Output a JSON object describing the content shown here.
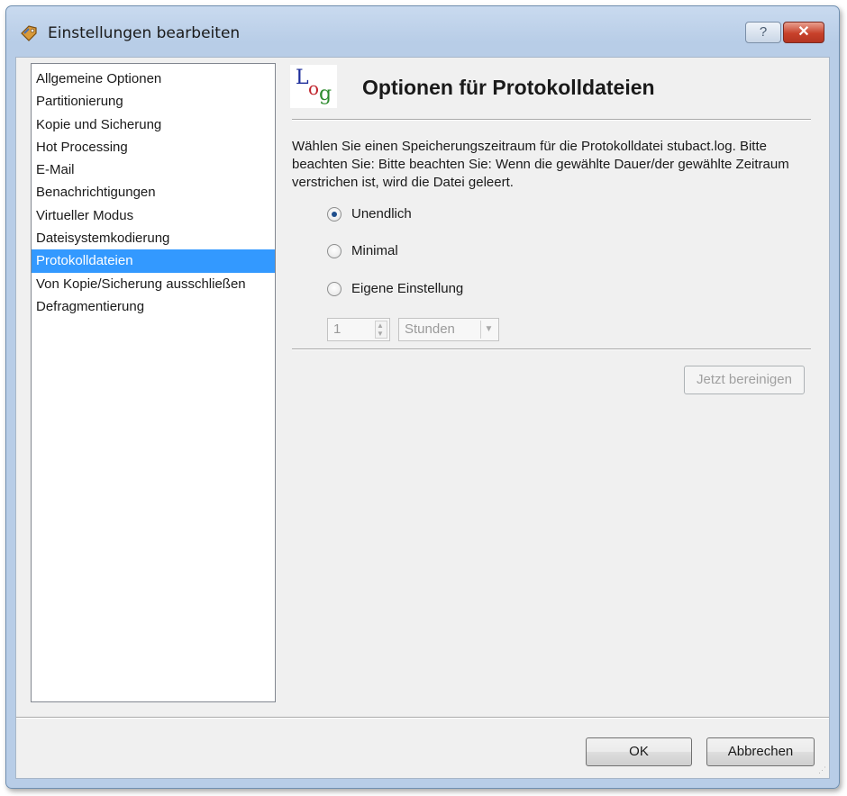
{
  "window": {
    "title": "Einstellungen bearbeiten",
    "help_label": "?",
    "close_label": "✕",
    "title_icon": "settings-tag-icon"
  },
  "sidebar": {
    "items": [
      {
        "label": "Allgemeine Optionen",
        "selected": false
      },
      {
        "label": "Partitionierung",
        "selected": false
      },
      {
        "label": "Kopie und Sicherung",
        "selected": false
      },
      {
        "label": "Hot Processing",
        "selected": false
      },
      {
        "label": "E-Mail",
        "selected": false
      },
      {
        "label": "Benachrichtigungen",
        "selected": false
      },
      {
        "label": "Virtueller Modus",
        "selected": false
      },
      {
        "label": "Dateisystemkodierung",
        "selected": false
      },
      {
        "label": "Protokolldateien",
        "selected": true
      },
      {
        "label": "Von Kopie/Sicherung ausschließen",
        "selected": false
      },
      {
        "label": "Defragmentierung",
        "selected": false
      }
    ]
  },
  "panel": {
    "logo": {
      "l": "L",
      "o": "o",
      "g": "g"
    },
    "title": "Optionen für Protokolldateien",
    "description": "Wählen Sie einen Speicherungszeitraum für die Protokolldatei stubact.log. Bitte beachten Sie: Bitte beachten Sie: Wenn die gewählte Dauer/der gewählte Zeitraum verstrichen ist, wird die Datei geleert.",
    "options": [
      {
        "label": "Unendlich",
        "checked": true
      },
      {
        "label": "Minimal",
        "checked": false
      },
      {
        "label": "Eigene Einstellung",
        "checked": false
      }
    ],
    "duration_value": "1",
    "unit_value": "Stunden",
    "clear_button": "Jetzt bereinigen"
  },
  "footer": {
    "ok_label": "OK",
    "cancel_label": "Abbrechen"
  },
  "colors": {
    "selection": "#3399ff",
    "title_bar": "#b8cde7",
    "close_button": "#c8412b"
  }
}
